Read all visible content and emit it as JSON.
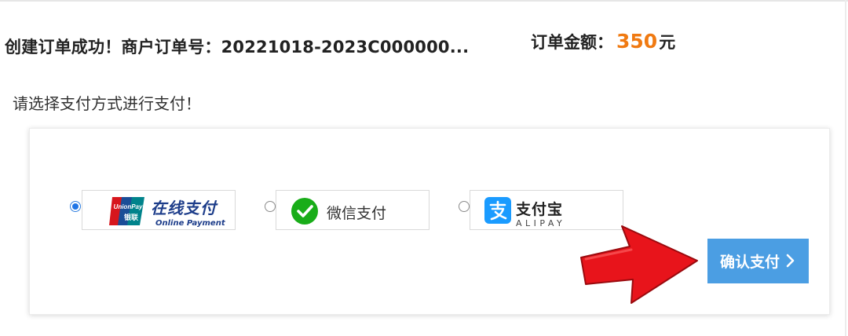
{
  "order": {
    "message": "创建订单成功！商户订单号：20221018-2023C000000...",
    "amount_label": "订单金额：",
    "amount_value": "350",
    "amount_unit": "元"
  },
  "choose_tip": "请选择支付方式进行支付！",
  "payment_options": [
    {
      "id": "unionpay",
      "selected": true,
      "logo_text": [
        "UnionPay",
        "银联"
      ],
      "title": "在线支付",
      "subtitle": "Online Payment"
    },
    {
      "id": "wechat",
      "selected": false,
      "label": "微信支付"
    },
    {
      "id": "alipay",
      "selected": false,
      "title": "支付宝",
      "subtitle": "ALIPAY"
    }
  ],
  "confirm_button": {
    "label": "确认支付"
  },
  "colors": {
    "amount": "#f07a12",
    "button": "#4b9ee3",
    "radio_selected": "#1f75e6",
    "arrow": "#e8141b",
    "wechat": "#19ad19",
    "alipay": "#1a9bff",
    "unionpay_red": "#d7161d",
    "unionpay_blue": "#1b4d97",
    "unionpay_green": "#00838b"
  },
  "icons": [
    "unionpay-logo-icon",
    "wechat-icon",
    "alipay-icon",
    "chevron-right-icon",
    "red-arrow-icon"
  ]
}
